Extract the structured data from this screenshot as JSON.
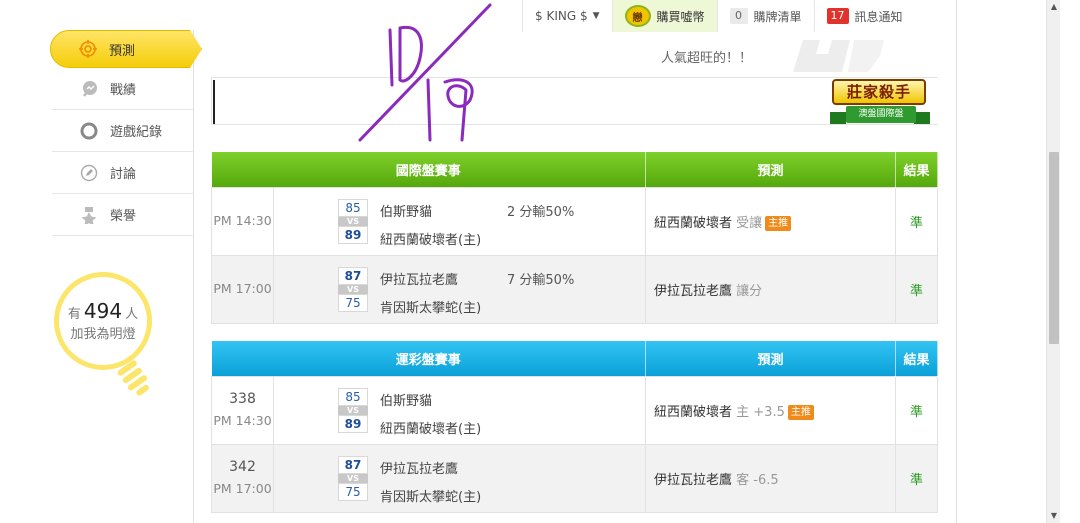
{
  "topbar": {
    "user": "$ KING $",
    "buy_coin_icon": "戀",
    "buy_label": "購買噓幣",
    "cart_count": "0",
    "cart_label": "購牌清單",
    "notify_count": "17",
    "notify_label": "訊息通知"
  },
  "sidebar": {
    "items": [
      {
        "label": "預測",
        "icon": "target-icon"
      },
      {
        "label": "戰績",
        "icon": "chart-icon"
      },
      {
        "label": "遊戲紀錄",
        "icon": "ring-icon"
      },
      {
        "label": "討論",
        "icon": "pencil-icon"
      },
      {
        "label": "榮譽",
        "icon": "medal-icon"
      }
    ]
  },
  "lamp": {
    "prefix": "有",
    "count": "494",
    "suffix": "人",
    "line2": "加我為明燈"
  },
  "banner": {
    "praise": "人氣超旺的！！",
    "promo_title": "莊家殺手",
    "promo_sub": "澳盤國際盤"
  },
  "intl_table": {
    "headers": [
      "國際盤賽事",
      "預測",
      "結果"
    ],
    "rows": [
      {
        "no": "",
        "time": "PM 14:30",
        "score1": "85",
        "score2": "89",
        "team1": "伯斯野貓",
        "team2": "紐西蘭破壞者(主)",
        "spread": "2 分輸50%",
        "pred_team": "紐西蘭破壞者",
        "pred_sub": "受讓",
        "pred_tag": "主推",
        "result": "準"
      },
      {
        "no": "",
        "time": "PM 17:00",
        "score1": "87",
        "score2": "75",
        "team1": "伊拉瓦拉老鷹",
        "team2": "肯因斯太攀蛇(主)",
        "spread": "7 分輸50%",
        "pred_team": "伊拉瓦拉老鷹",
        "pred_sub": "讓分",
        "pred_tag": "",
        "result": "準"
      }
    ]
  },
  "lottery_table": {
    "headers": [
      "運彩盤賽事",
      "預測",
      "結果"
    ],
    "rows": [
      {
        "no": "338",
        "time": "PM 14:30",
        "score1": "85",
        "score2": "89",
        "team1": "伯斯野貓",
        "team2": "紐西蘭破壞者(主)",
        "spread": "",
        "pred_team": "紐西蘭破壞者",
        "pred_sub": "主 +3.5",
        "pred_tag": "主推",
        "result": "準"
      },
      {
        "no": "342",
        "time": "PM 17:00",
        "score1": "87",
        "score2": "75",
        "team1": "伊拉瓦拉老鷹",
        "team2": "肯因斯太攀蛇(主)",
        "spread": "",
        "pred_team": "伊拉瓦拉老鷹",
        "pred_sub": "客 -6.5",
        "pred_tag": "",
        "result": "準"
      }
    ]
  },
  "vs_label": "VS",
  "handwriting": "10/19"
}
